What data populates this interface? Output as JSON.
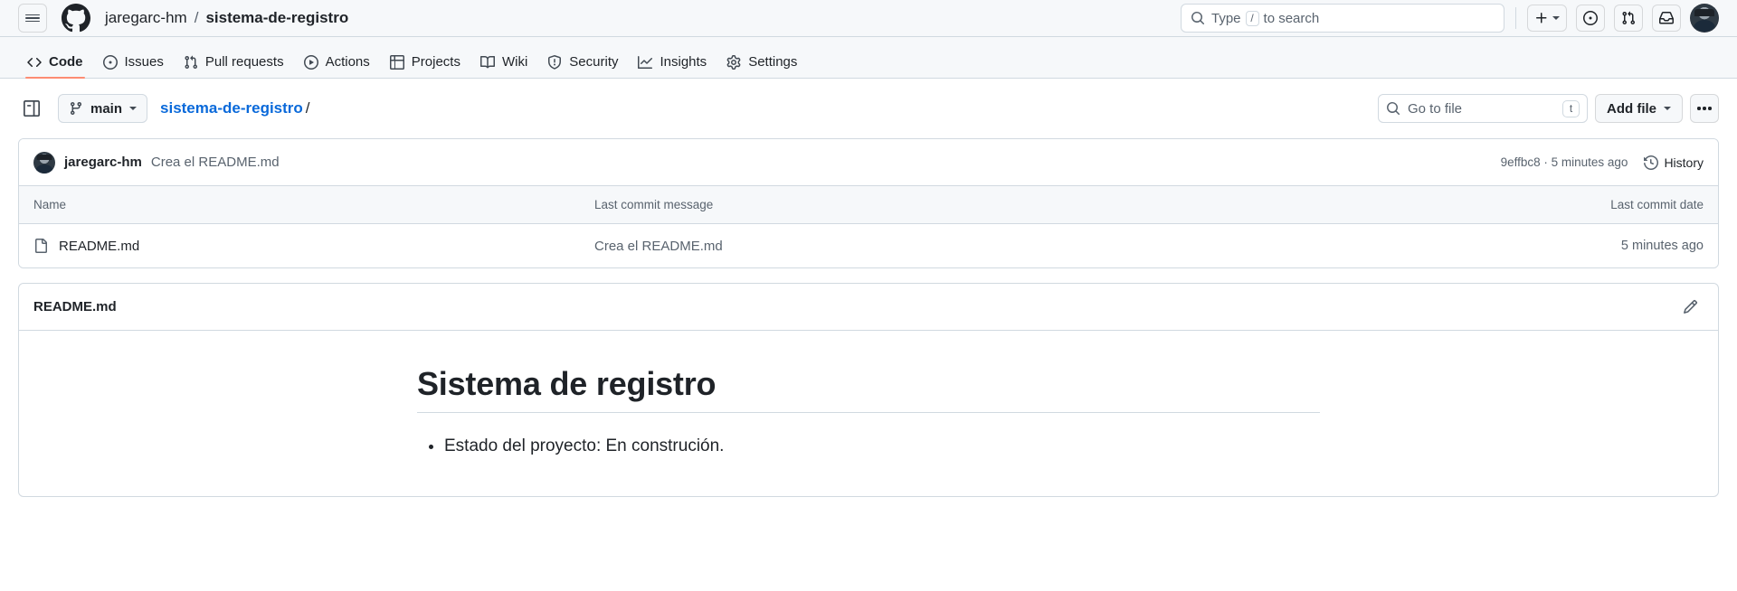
{
  "header": {
    "hamburger_label": "Open global navigation menu",
    "logo_label": "GitHub",
    "owner": "jaregarc-hm",
    "separator": "/",
    "repo": "sistema-de-registro",
    "search": {
      "placeholder_prefix": "Type",
      "kbd": "/",
      "placeholder_suffix": "to search"
    },
    "actions": {
      "create_new_label": "Create new...",
      "issues_label": "Your issues",
      "pull_requests_label": "Your pull requests",
      "inbox_label": "Notifications",
      "avatar_label": "Open user account menu"
    }
  },
  "repo_nav": {
    "items": [
      {
        "label": "Code",
        "icon": "code-icon",
        "active": true
      },
      {
        "label": "Issues",
        "icon": "issue-opened-icon",
        "active": false
      },
      {
        "label": "Pull requests",
        "icon": "git-pull-request-icon",
        "active": false
      },
      {
        "label": "Actions",
        "icon": "play-icon",
        "active": false
      },
      {
        "label": "Projects",
        "icon": "table-icon",
        "active": false
      },
      {
        "label": "Wiki",
        "icon": "book-icon",
        "active": false
      },
      {
        "label": "Security",
        "icon": "shield-icon",
        "active": false
      },
      {
        "label": "Insights",
        "icon": "graph-icon",
        "active": false
      },
      {
        "label": "Settings",
        "icon": "gear-icon",
        "active": false
      }
    ],
    "active_underline_color": "#fd8c73"
  },
  "branch_row": {
    "sidebar_toggle_label": "Expand file tree",
    "branch": "main",
    "breadcrumb_repo": "sistema-de-registro",
    "breadcrumb_separator": "/",
    "go_to_file_placeholder": "Go to file",
    "go_to_file_kbd": "t",
    "add_file_label": "Add file",
    "more_options_label": "More options"
  },
  "commit": {
    "author": "jaregarc-hm",
    "message": "Crea el README.md",
    "hash_and_time": "9effbc8 · 5 minutes ago",
    "history_label": "History"
  },
  "file_table": {
    "columns": [
      "Name",
      "Last commit message",
      "Last commit date"
    ],
    "rows": [
      {
        "icon": "file-icon",
        "name": "README.md",
        "message": "Crea el README.md",
        "date": "5 minutes ago"
      }
    ]
  },
  "readme": {
    "title": "README.md",
    "edit_label": "Edit README",
    "heading": "Sistema de registro",
    "bullets": [
      "Estado del proyecto: En construción."
    ]
  },
  "colors": {
    "accent_link": "#0969da",
    "header_bg": "#f6f8fa",
    "border": "#d1d9e0",
    "text_primary": "#1f2328",
    "text_muted": "#59636e",
    "active_tab_underline": "#fd8c73"
  }
}
